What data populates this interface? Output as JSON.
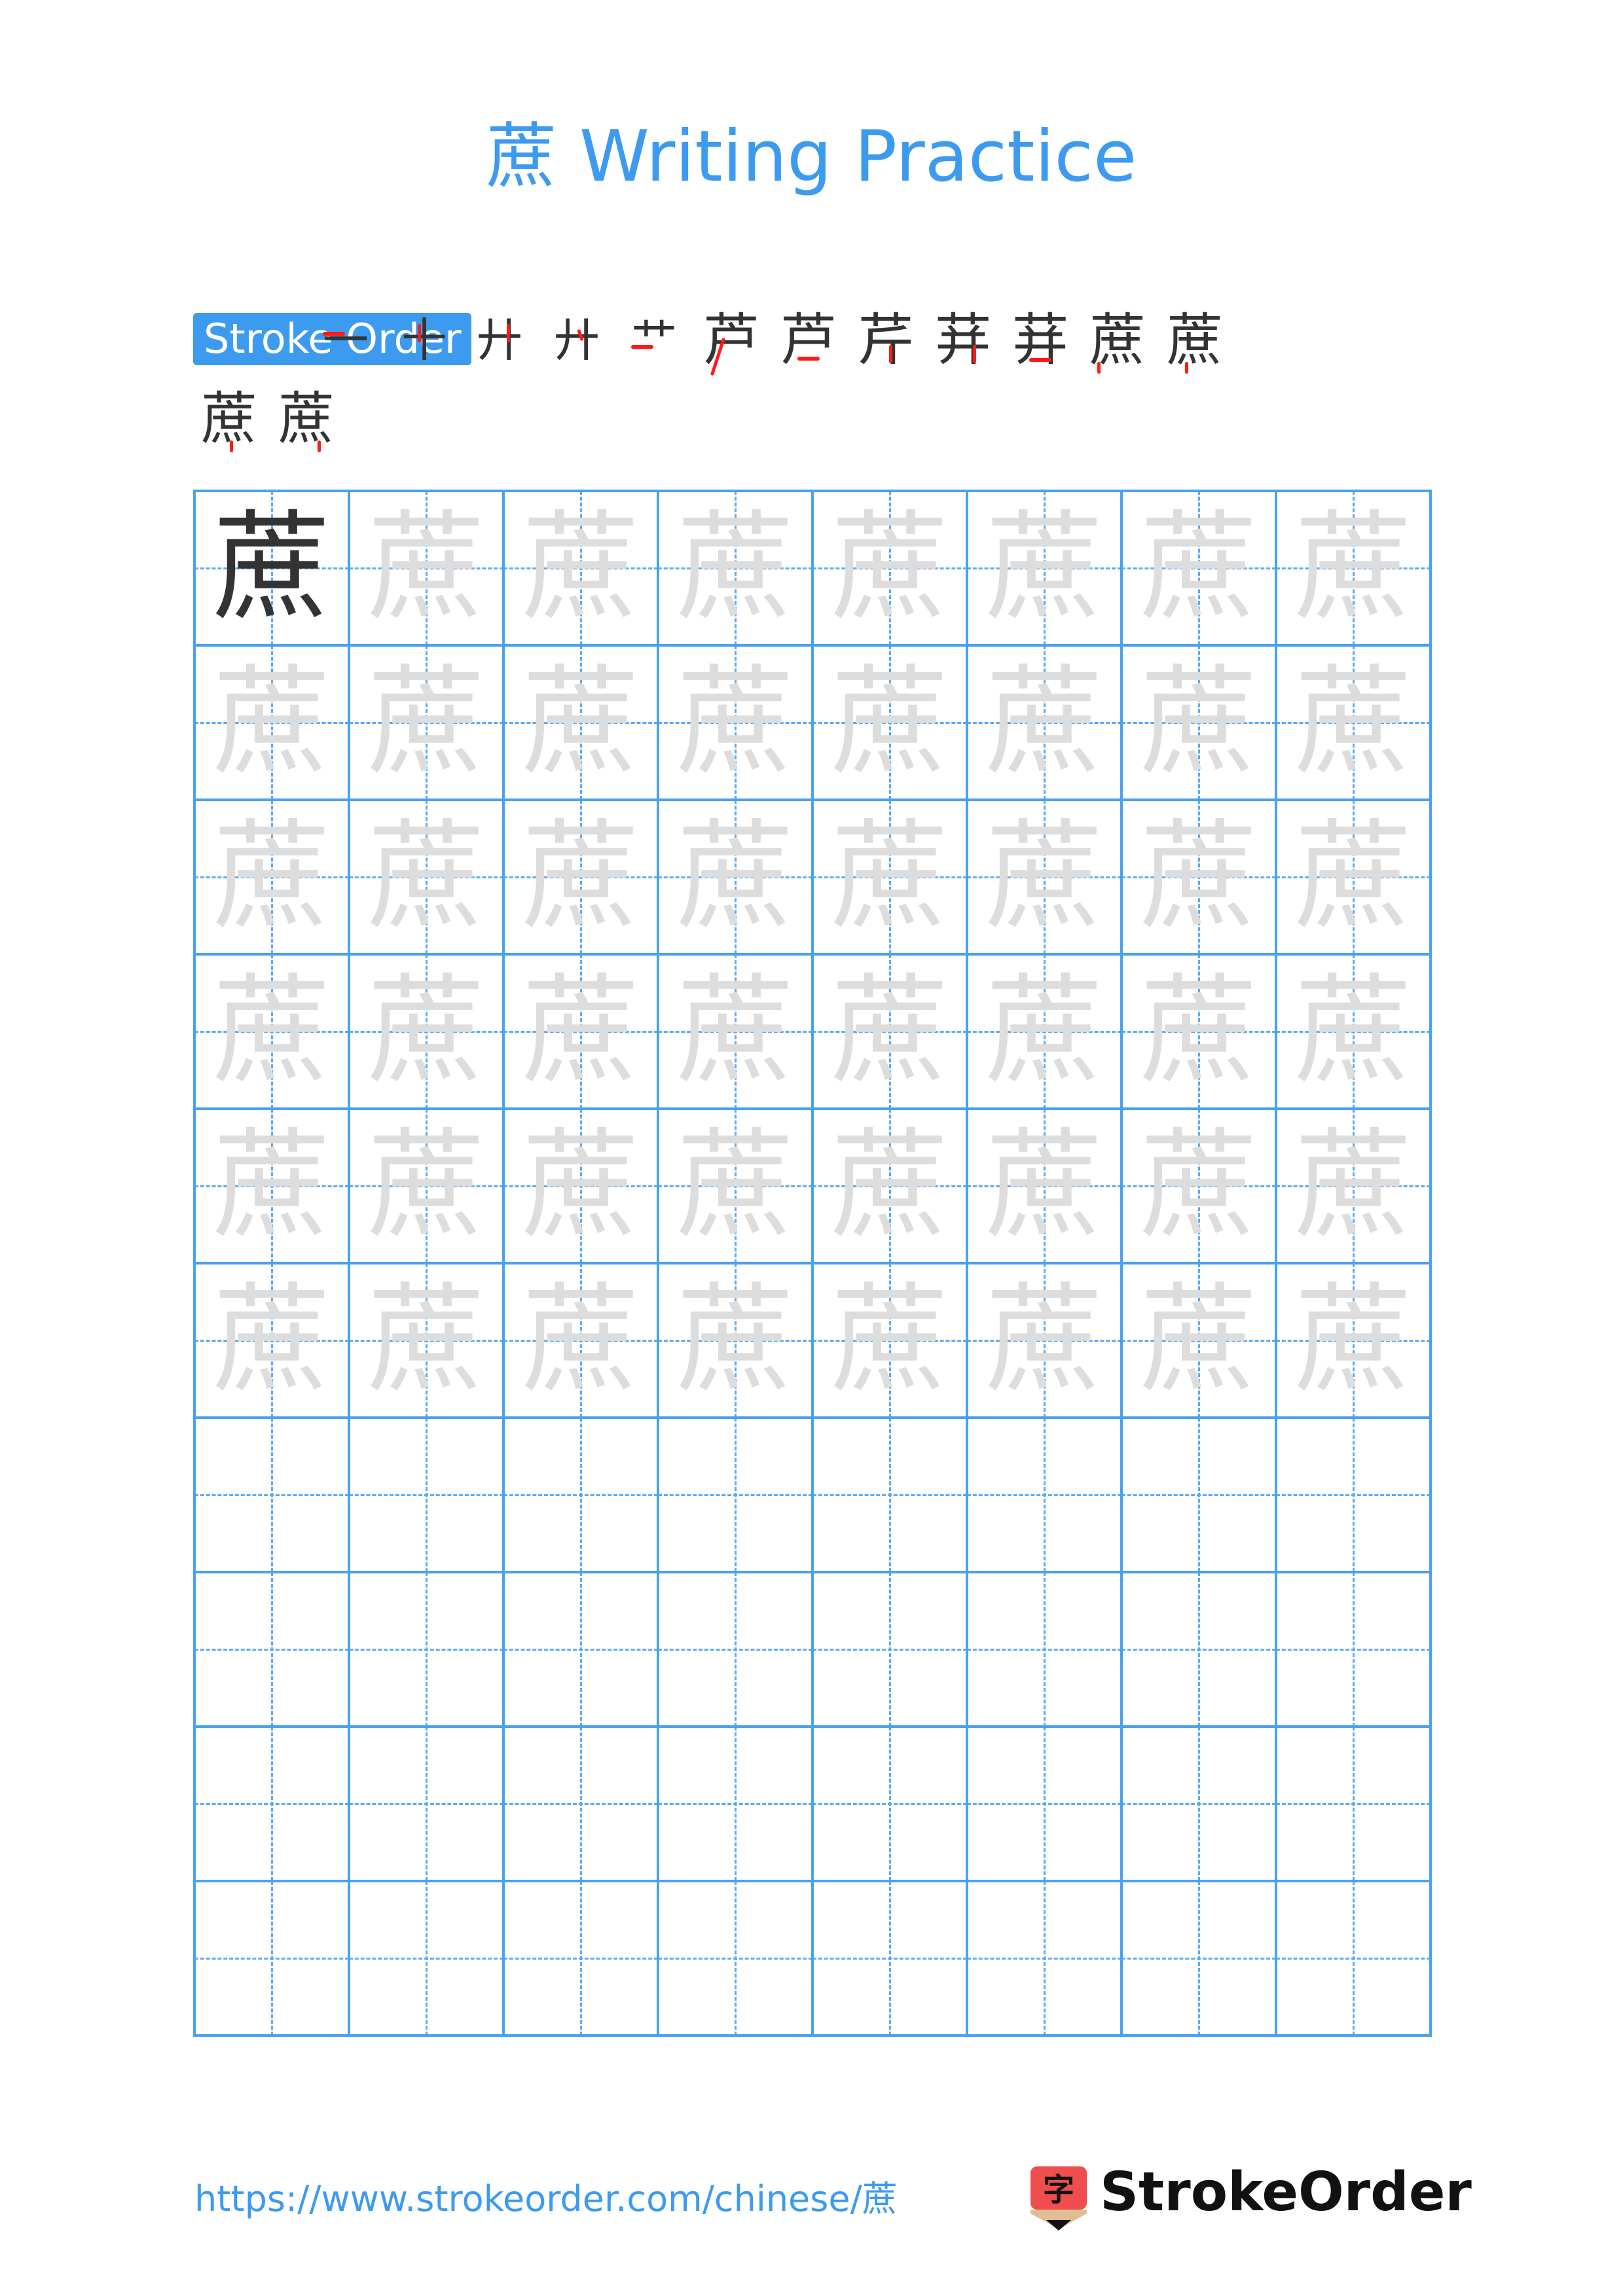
{
  "header": {
    "title": "蔗 Writing Practice"
  },
  "stroke_order": {
    "label": "Stroke Order",
    "character": "蔗",
    "total_strokes": 14,
    "steps": [
      {
        "step": 1,
        "shape": "一",
        "highlight": "horizontal"
      },
      {
        "step": 2,
        "shape": "十",
        "highlight": "vertical"
      },
      {
        "step": 3,
        "shape": "廾",
        "highlight": "vertical"
      },
      {
        "step": 4,
        "shape": "廾",
        "highlight": "short-left-falling"
      },
      {
        "step": 5,
        "shape": "艹",
        "highlight": "horizontal"
      },
      {
        "step": 6,
        "shape": "芦",
        "highlight": "left-falling"
      },
      {
        "step": 7,
        "shape": "芦",
        "highlight": "horizontal"
      },
      {
        "step": 8,
        "shape": "芹",
        "highlight": "vertical"
      },
      {
        "step": 9,
        "shape": "荓",
        "highlight": "vertical"
      },
      {
        "step": 10,
        "shape": "荓",
        "highlight": "horizontal"
      },
      {
        "step": 11,
        "shape": "蔗",
        "highlight": "dot-1"
      },
      {
        "step": 12,
        "shape": "蔗",
        "highlight": "dot-2"
      },
      {
        "step": 13,
        "shape": "蔗",
        "highlight": "dot-3"
      },
      {
        "step": 14,
        "shape": "蔗",
        "highlight": "dot-4"
      }
    ]
  },
  "practice_grid": {
    "character": "蔗",
    "columns": 8,
    "rows": 10,
    "model_rows": 1,
    "trace_rows": 5,
    "blank_rows": 4,
    "colors": {
      "grid": "#4aa1ef",
      "model": "#333333",
      "trace": "#dddddd"
    }
  },
  "footer": {
    "url": "https://www.strokeorder.com/chinese/蔗",
    "logo_char": "字",
    "logo_text": "StrokeOrder"
  },
  "colors": {
    "accent": "#3d9bef",
    "highlight_stroke": "#ff1a1a",
    "logo_red": "#f04e4e",
    "logo_tan": "#e0bd94"
  }
}
